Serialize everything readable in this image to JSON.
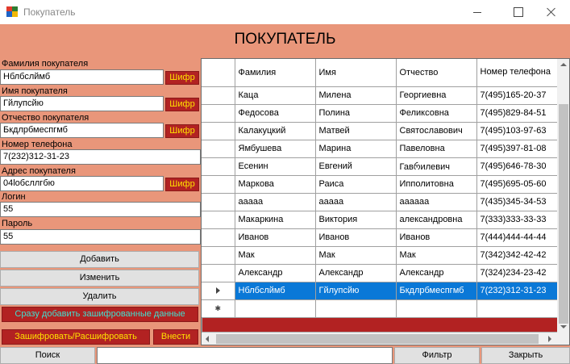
{
  "window": {
    "title": "Покупатель"
  },
  "header": {
    "title": "ПОКУПАТЕЛЬ"
  },
  "form": {
    "last_name_label": "Фамилия покупателя",
    "last_name_value": "Нблбслймб",
    "first_name_label": "Имя покупателя",
    "first_name_value": "Гйлупсйю",
    "patronymic_label": "Отчество покупателя",
    "patronymic_value": "Бкдлрбмеспгмб",
    "phone_label": "Номер телефона",
    "phone_value": "7(232)312-31-23",
    "address_label": "Адрес покупателя",
    "address_value": "04lобсллгбю",
    "login_label": "Логин",
    "login_value": "55",
    "password_label": "Пароль",
    "password_value": "55",
    "cipher_label": "Шифр"
  },
  "actions": {
    "add": "Добавить",
    "edit": "Изменить",
    "delete": "Удалить",
    "add_encrypted": "Сразу добавить зашифрованные данные",
    "encrypt_decrypt": "Зашифровать/Расшифровать",
    "insert": "Внести"
  },
  "grid": {
    "columns": [
      "Фамилия",
      "Имя",
      "Отчество",
      "Номер телефона"
    ],
    "rows": [
      [
        "Каца",
        "Милена",
        "Георгиевна",
        "7(495)165-20-37"
      ],
      [
        "Федосова",
        "Полина",
        "Феликсовна",
        "7(495)829-84-51"
      ],
      [
        "Калакуцкий",
        "Матвей",
        "Святославович",
        "7(495)103-97-63"
      ],
      [
        "Ямбушева",
        "Марина",
        "Павеловна",
        "7(495)397-81-08"
      ],
      [
        "Есенин",
        "Евгений",
        "Гавრилевич",
        "7(495)646-78-30"
      ],
      [
        "Маркова",
        "Раиса",
        "Ипполитовна",
        "7(495)695-05-60"
      ],
      [
        "ааааа",
        "ааааа",
        "аааааа",
        "7(435)345-34-53"
      ],
      [
        "Макаркина",
        "Виктория",
        "александровна",
        "7(333)333-33-33"
      ],
      [
        "Иванов",
        "Иванов",
        "Иванов",
        "7(444)444-44-44"
      ],
      [
        "Мак",
        "Мак",
        "Мак",
        "7(342)342-42-42"
      ],
      [
        "Александр",
        "Александр",
        "Александр",
        "7(324)234-23-42"
      ],
      [
        "Нблбслймб",
        "Гйлупсйю",
        "Бкдлрбмеспгмб",
        "7(232)312-31-23"
      ]
    ],
    "selected_row": 11
  },
  "bottom": {
    "search": "Поиск",
    "filter": "Фильтр",
    "close": "Закрыть"
  },
  "colors": {
    "form_background": "#e9967a",
    "accent_red": "#b22222",
    "accent_yellow": "#ffe100",
    "add_encrypted_text": "#40e0d0",
    "selection": "#0a78d7"
  }
}
